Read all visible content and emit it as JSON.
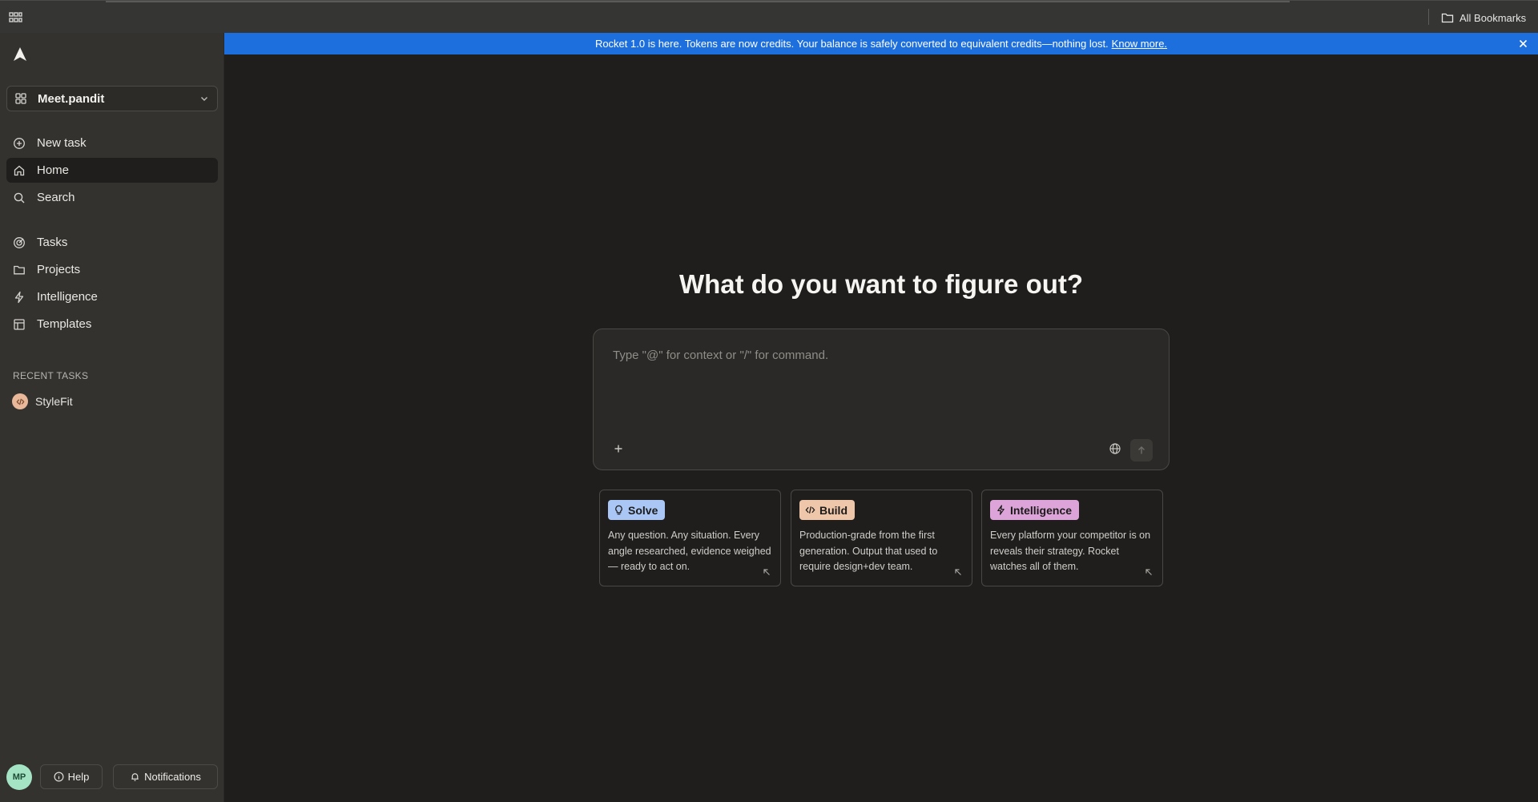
{
  "browser": {
    "all_bookmarks_label": "All Bookmarks"
  },
  "sidebar": {
    "workspace_name": "Meet.pandit",
    "nav_primary": [
      {
        "label": "New task",
        "icon": "plus-circle-icon"
      },
      {
        "label": "Home",
        "icon": "home-icon",
        "active": true
      },
      {
        "label": "Search",
        "icon": "search-icon"
      }
    ],
    "nav_secondary": [
      {
        "label": "Tasks",
        "icon": "target-icon"
      },
      {
        "label": "Projects",
        "icon": "folder-icon"
      },
      {
        "label": "Intelligence",
        "icon": "bolt-icon"
      },
      {
        "label": "Templates",
        "icon": "layout-icon"
      }
    ],
    "recent_title": "RECENT TASKS",
    "recent_tasks": [
      {
        "label": "StyleFit",
        "icon": "code-icon"
      }
    ],
    "footer": {
      "avatar_initials": "MP",
      "help_label": "Help",
      "notifications_label": "Notifications"
    }
  },
  "banner": {
    "text": "Rocket 1.0 is here. Tokens are now credits. Your balance is safely converted to equivalent credits—nothing lost.",
    "link_label": "Know more."
  },
  "main": {
    "headline": "What do you want to figure out?",
    "composer": {
      "placeholder": "Type \"@\" for context or \"/\" for command."
    },
    "cards": [
      {
        "label": "Solve",
        "icon": "lightbulb-icon",
        "chip_color": "#a9c6f4",
        "description": "Any question. Any situation. Every angle researched, evidence weighed — ready to act on."
      },
      {
        "label": "Build",
        "icon": "code-icon",
        "chip_color": "#eec6a9",
        "description": "Production-grade from the first generation. Output that used to require design+dev team."
      },
      {
        "label": "Intelligence",
        "icon": "bolt-icon",
        "chip_color": "#dca4d8",
        "description": "Every platform your competitor is on reveals their strategy. Rocket watches all of them."
      }
    ]
  },
  "colors": {
    "banner_bg": "#1e6fde",
    "sidebar_bg": "#34322f",
    "main_bg": "#1f1e1d",
    "avatar_bg": "#a5e3c5"
  }
}
